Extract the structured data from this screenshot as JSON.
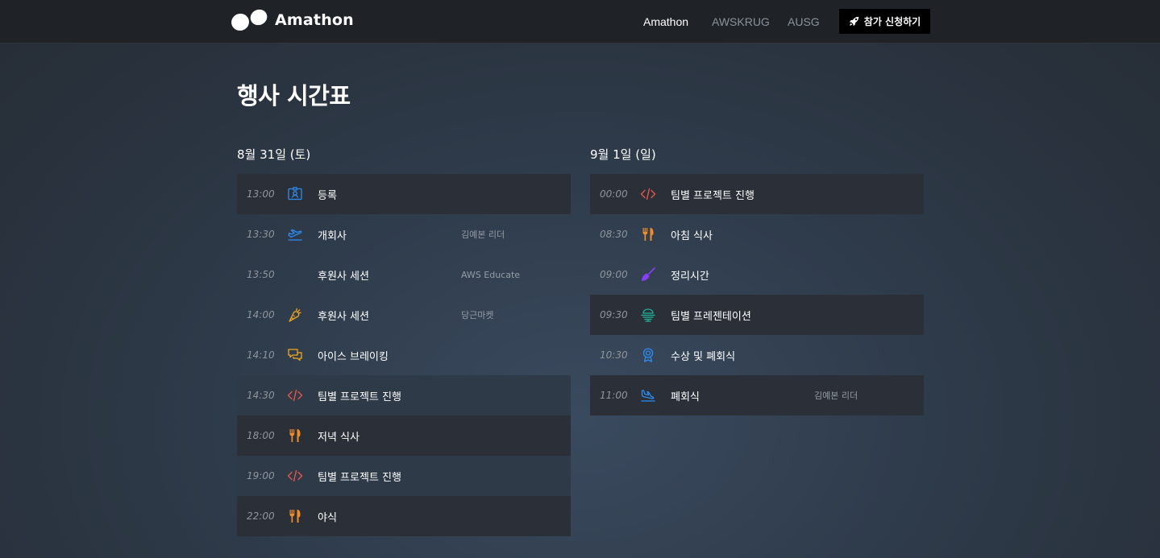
{
  "header": {
    "logo_text": "Amathon",
    "nav": [
      "Amathon",
      "AWSKRUG",
      "AUSG"
    ],
    "join_label": "참가 신청하기"
  },
  "page": {
    "title": "행사 시간표"
  },
  "days": [
    {
      "title": "8월 31일 (토)",
      "events": [
        {
          "time": "13:00",
          "icon": "id-badge-icon",
          "title": "등록",
          "speaker": ""
        },
        {
          "time": "13:30",
          "icon": "plane-takeoff-icon",
          "title": "개회사",
          "speaker": "김예본 리더"
        },
        {
          "time": "13:50",
          "icon": "none",
          "title": "후원사 세션",
          "speaker": "AWS Educate"
        },
        {
          "time": "14:00",
          "icon": "carrot-icon",
          "title": "후원사 세션",
          "speaker": "당근마켓"
        },
        {
          "time": "14:10",
          "icon": "chat-bubbles-icon",
          "title": "아이스 브레이킹",
          "speaker": ""
        },
        {
          "time": "14:30",
          "icon": "code-icon",
          "title": "팀별 프로젝트 진행",
          "speaker": ""
        },
        {
          "time": "18:00",
          "icon": "utensils-icon",
          "title": "저녁 식사",
          "speaker": ""
        },
        {
          "time": "19:00",
          "icon": "code-icon",
          "title": "팀별 프로젝트 진행",
          "speaker": ""
        },
        {
          "time": "22:00",
          "icon": "utensils-icon",
          "title": "야식",
          "speaker": ""
        }
      ]
    },
    {
      "title": "9월 1일 (일)",
      "events": [
        {
          "time": "00:00",
          "icon": "code-icon",
          "title": "팀별 프로젝트 진행",
          "speaker": ""
        },
        {
          "time": "08:30",
          "icon": "utensils-icon",
          "title": "아침 식사",
          "speaker": ""
        },
        {
          "time": "09:00",
          "icon": "broom-icon",
          "title": "정리시간",
          "speaker": ""
        },
        {
          "time": "09:30",
          "icon": "presentation-icon",
          "title": "팀별 프레젠테이션",
          "speaker": ""
        },
        {
          "time": "10:30",
          "icon": "award-icon",
          "title": "수상 및 폐회식",
          "speaker": ""
        },
        {
          "time": "11:00",
          "icon": "plane-landing-icon",
          "title": "폐회식",
          "speaker": "김예본 리더"
        }
      ]
    }
  ],
  "colors": {
    "topbar": "#1f2328",
    "row_dark": "#2b3038",
    "row_highlight": "#2f3a48",
    "icon_blue": "#2d8cf0",
    "icon_orange": "#f28c28",
    "icon_red": "#e4554b",
    "icon_purple": "#8a3ffc",
    "icon_teal": "#1fb29b",
    "icon_gold": "#f0a81c"
  }
}
